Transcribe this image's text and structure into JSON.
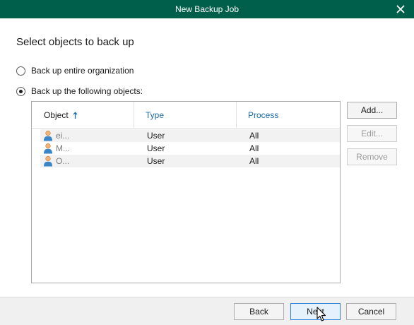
{
  "window": {
    "title": "New Backup Job"
  },
  "heading": "Select objects to back up",
  "options": {
    "entire_org": {
      "label": "Back up entire organization",
      "checked": false
    },
    "following": {
      "label": "Back up the following objects:",
      "checked": true
    }
  },
  "grid": {
    "columns": [
      {
        "label": "Object",
        "sorted": "ascending"
      },
      {
        "label": "Type"
      },
      {
        "label": "Process"
      }
    ],
    "rows": [
      {
        "object": "ei...",
        "type": "User",
        "process": "All"
      },
      {
        "object": "M...",
        "type": "User",
        "process": "All"
      },
      {
        "object": "O...",
        "type": "User",
        "process": "All"
      }
    ]
  },
  "side_buttons": {
    "add": {
      "label": "Add...",
      "enabled": true
    },
    "edit": {
      "label": "Edit...",
      "enabled": false
    },
    "remove": {
      "label": "Remove",
      "enabled": false
    }
  },
  "footer": {
    "back": "Back",
    "next": "Next",
    "cancel": "Cancel"
  },
  "colors": {
    "titlebar": "#005f4b",
    "header_link": "#1b6aa8",
    "primary_border": "#2f7ed8"
  },
  "icons": {
    "close": "close-icon",
    "sort": "sort-ascending-icon",
    "user": "user-icon",
    "cursor": "mouse-pointer-icon"
  }
}
